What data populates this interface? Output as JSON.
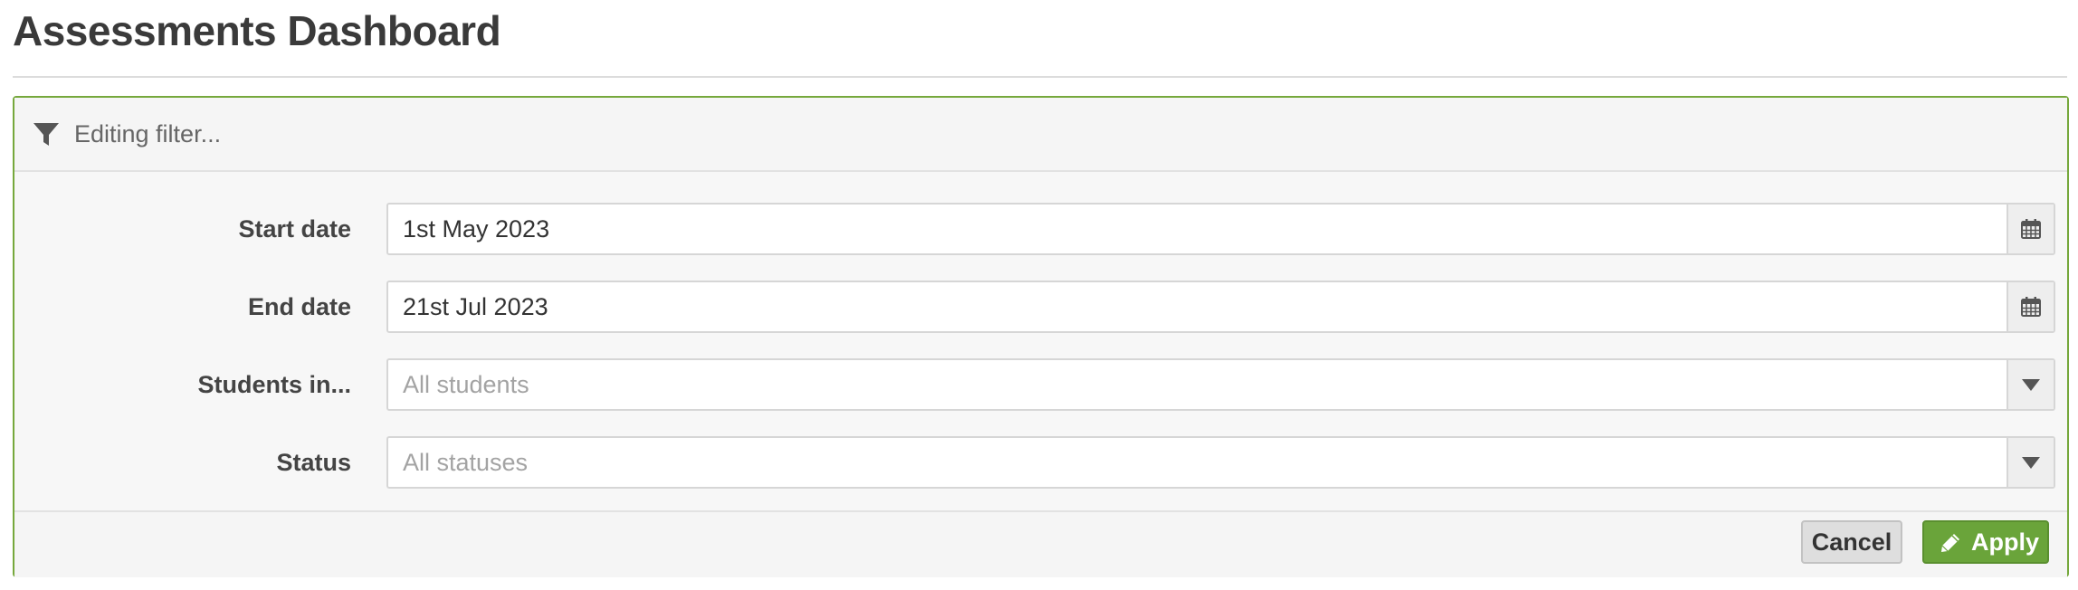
{
  "page": {
    "title": "Assessments Dashboard"
  },
  "filter_panel": {
    "header_text": "Editing filter...",
    "header_icon": "filter-icon",
    "fields": {
      "start_date": {
        "label": "Start date",
        "value": "1st May 2023",
        "addon_icon": "calendar-icon"
      },
      "end_date": {
        "label": "End date",
        "value": "21st Jul 2023",
        "addon_icon": "calendar-icon"
      },
      "students_in": {
        "label": "Students in...",
        "placeholder": "All students",
        "addon_icon": "caret-down-icon"
      },
      "status": {
        "label": "Status",
        "placeholder": "All statuses",
        "addon_icon": "caret-down-icon"
      }
    },
    "footer": {
      "cancel_label": "Cancel",
      "apply_label": "Apply",
      "apply_icon": "pencil-icon"
    }
  },
  "colors": {
    "accent_green": "#6aa43a",
    "panel_border": "#76a83c",
    "panel_background": "#f7f7f7",
    "text_primary": "#333333",
    "placeholder": "#a3a3a3"
  }
}
